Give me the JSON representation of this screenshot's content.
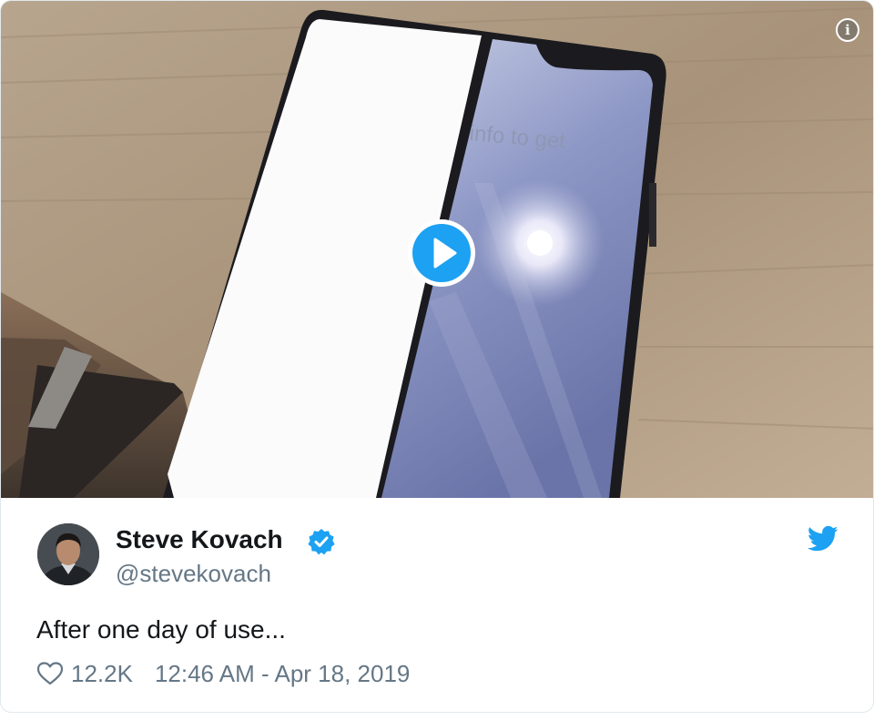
{
  "media": {
    "screen_text": "info to get",
    "info_icon": "info-icon",
    "play_icon": "play-icon"
  },
  "tweet": {
    "author": {
      "name": "Steve Kovach",
      "handle": "@stevekovach",
      "verified": true
    },
    "text": "After one day of use...",
    "likes": "12.2K",
    "timestamp": "12:46 AM - Apr 18, 2019"
  },
  "colors": {
    "accent": "#1da1f2",
    "text": "#14171a",
    "muted": "#657786",
    "border": "#e1e8ed"
  },
  "icons": {
    "verified": "verified-badge-icon",
    "brand": "twitter-bird-icon",
    "like": "heart-icon"
  }
}
